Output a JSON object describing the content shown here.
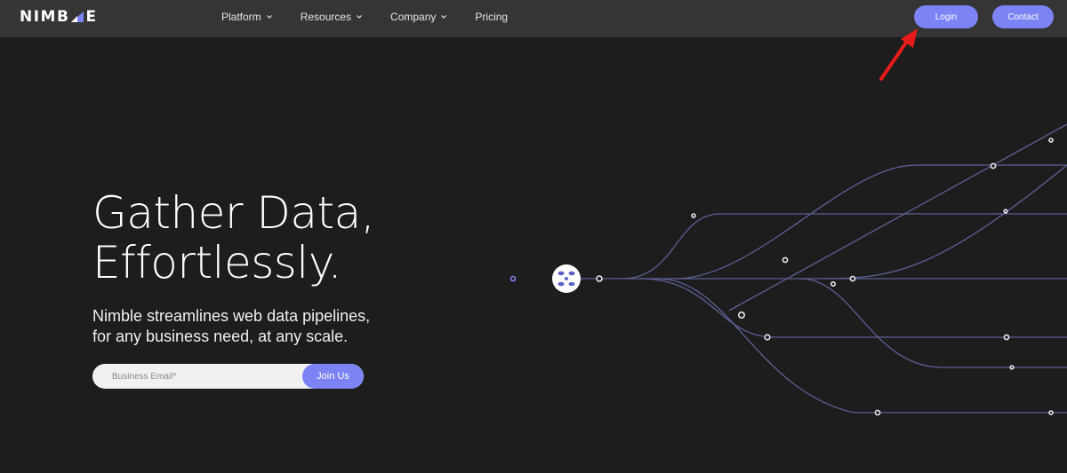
{
  "nav": {
    "logo_left": "NIMB",
    "logo_right": "E",
    "items": [
      {
        "label": "Platform",
        "has_dropdown": true
      },
      {
        "label": "Resources",
        "has_dropdown": true
      },
      {
        "label": "Company",
        "has_dropdown": true
      },
      {
        "label": "Pricing",
        "has_dropdown": false
      }
    ],
    "login_label": "Login",
    "contact_label": "Contact"
  },
  "hero": {
    "title_line1": "Gather Data,",
    "title_line2": "Effortlessly.",
    "subtitle_line1": "Nimble streamlines web data pipelines,",
    "subtitle_line2": "for any business need, at any scale.",
    "email_placeholder": "Business Email*",
    "join_label": "Join Us"
  },
  "colors": {
    "accent": "#7c83f5",
    "background": "#1d1d1d",
    "navbar": "#353535",
    "annotation_arrow": "#e81b1b"
  },
  "icons": {
    "nav_dropdown": "chevron-down-icon",
    "annotation": "red-arrow-icon",
    "hub": "nimble-hub-icon"
  }
}
